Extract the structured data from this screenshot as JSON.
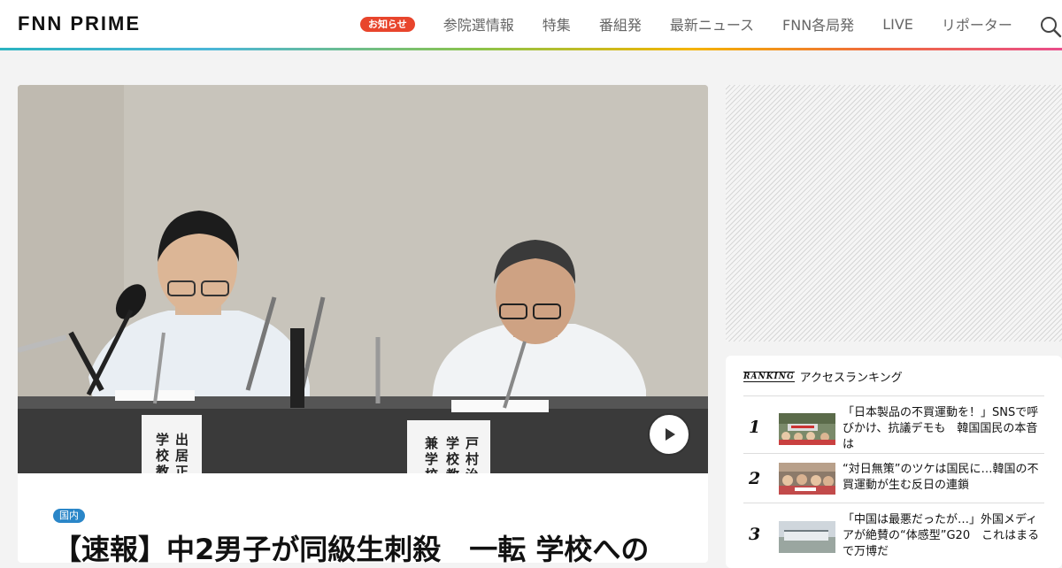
{
  "header": {
    "logo": "FNN PRIME",
    "notice": "お知らせ",
    "nav": [
      "参院選情報",
      "特集",
      "番組発",
      "最新ニュース",
      "FNN各局発",
      "LIVE",
      "リポーター"
    ],
    "search_icon": "search-icon"
  },
  "article": {
    "badge": "国内",
    "headline": "【速報】中2男子が同級生刺殺　一転 学校への",
    "play_icon": "play-icon",
    "nameplates": [
      [
        "出",
        "居",
        "正"
      ],
      [
        "学",
        "校",
        "教"
      ],
      [
        "戸",
        "村",
        "治"
      ],
      [
        "学",
        "校",
        "教"
      ],
      [
        "兼",
        "学",
        "校"
      ]
    ]
  },
  "ranking": {
    "logo": "RANKING",
    "heading": "アクセスランキング",
    "items": [
      {
        "rank": "1",
        "title": "「日本製品の不買運動を！」SNSで呼びかけ、抗議デモも　韓国国民の本音は"
      },
      {
        "rank": "2",
        "title": "“対日無策”のツケは国民に…韓国の不買運動が生む反日の連鎖"
      },
      {
        "rank": "3",
        "title": "「中国は最悪だったが…」外国メディアが絶賛の“体感型”G20　これはまるで万博だ"
      }
    ]
  },
  "colors": {
    "notice": "#e8452c",
    "badge": "#2a86c8"
  }
}
